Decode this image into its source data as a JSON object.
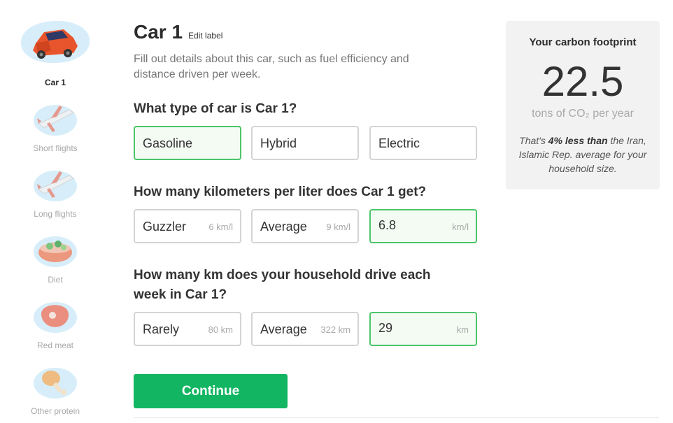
{
  "sidebar": {
    "items": [
      {
        "label": "Car 1",
        "icon": "car-icon",
        "active": true
      },
      {
        "label": "Short flights",
        "icon": "airplane-icon"
      },
      {
        "label": "Long flights",
        "icon": "airplane-icon"
      },
      {
        "label": "Diet",
        "icon": "salad-bowl-icon"
      },
      {
        "label": "Red meat",
        "icon": "steak-icon"
      },
      {
        "label": "Other protein",
        "icon": "chicken-leg-icon"
      }
    ]
  },
  "main": {
    "title": "Car 1",
    "edit_label": "Edit label",
    "description": "Fill out details about this car, such as fuel efficiency and distance driven per week.",
    "q1": {
      "text": "What type of car is Car 1?",
      "options": [
        "Gasoline",
        "Hybrid",
        "Electric"
      ],
      "selected": "Gasoline"
    },
    "q2": {
      "text": "How many kilometers per liter does Car 1 get?",
      "options": [
        {
          "label": "Guzzler",
          "hint": "6 km/l"
        },
        {
          "label": "Average",
          "hint": "9 km/l"
        }
      ],
      "custom_value": "6.8",
      "custom_unit": "km/l"
    },
    "q3": {
      "text": "How many km does your household drive each week in Car 1?",
      "options": [
        {
          "label": "Rarely",
          "hint": "80 km"
        },
        {
          "label": "Average",
          "hint": "322 km"
        }
      ],
      "custom_value": "29",
      "custom_unit": "km"
    },
    "continue_label": "Continue"
  },
  "card": {
    "title": "Your carbon footprint",
    "value": "22.5",
    "unit": "tons of CO₂ per year",
    "note_prefix": "That's ",
    "note_bold": "4% less than",
    "note_suffix": " the Iran, Islamic Rep. average for your household size."
  },
  "colors": {
    "accent_green": "#12b562",
    "selected_border": "#4cc56a",
    "selected_bg": "#f3fbf3",
    "card_bg": "#f2f2f2"
  }
}
